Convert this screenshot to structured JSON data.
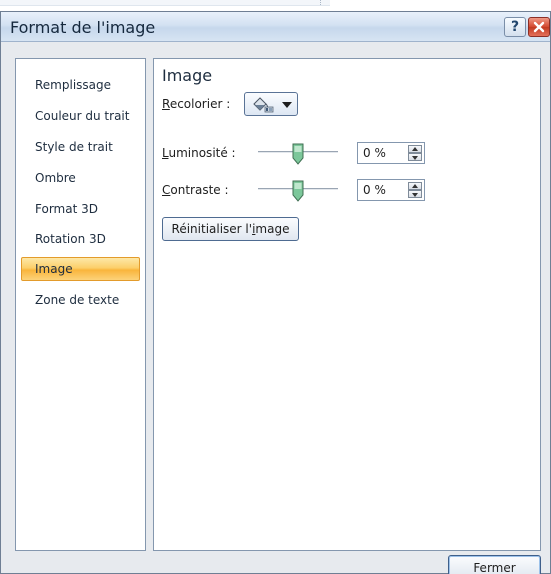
{
  "window": {
    "title": "Format de l'image",
    "help_label": "?"
  },
  "sidebar": {
    "items": [
      {
        "label": "Remplissage",
        "selected": false
      },
      {
        "label": "Couleur du trait",
        "selected": false
      },
      {
        "label": "Style de trait",
        "selected": false
      },
      {
        "label": "Ombre",
        "selected": false
      },
      {
        "label": "Format 3D",
        "selected": false
      },
      {
        "label": "Rotation 3D",
        "selected": false
      },
      {
        "label": "Image",
        "selected": true
      },
      {
        "label": "Zone de texte",
        "selected": false
      }
    ]
  },
  "panel": {
    "title": "Image",
    "recolor": {
      "key": "R",
      "rest": "ecolorier :",
      "icon": "paint-bucket-icon"
    },
    "brightness": {
      "key": "L",
      "rest": "uminosité :",
      "value_text": "0 %",
      "level": 0
    },
    "contrast": {
      "key": "C",
      "rest": "ontraste :",
      "value_text": "0 %",
      "level": 0
    },
    "reset": {
      "pre": "Réinitialiser l'",
      "key": "i",
      "post": "mage"
    }
  },
  "footer": {
    "close_label": "Fermer"
  },
  "colors": {
    "selected_item": "#fccf6a",
    "title_bar": "#d3e1f2",
    "close_button": "#d2462d"
  }
}
